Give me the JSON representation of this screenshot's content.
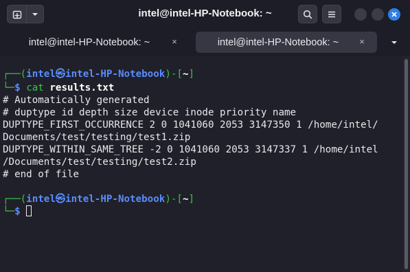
{
  "window": {
    "title": "intel@intel-HP-Notebook: ~"
  },
  "tabs": [
    {
      "label": "intel@intel-HP-Notebook: ~",
      "close": "×",
      "active": false
    },
    {
      "label": "intel@intel-HP-Notebook: ~",
      "close": "×",
      "active": true
    }
  ],
  "icons": {
    "new_tab": "new-tab-icon",
    "menu_dropdown": "chevron-down-icon",
    "search": "search-icon",
    "menu": "hamburger-menu-icon",
    "minimize": "minimize-icon",
    "maximize": "maximize-icon",
    "close": "close-icon",
    "tabs_dropdown": "chevron-down-icon"
  },
  "colors": {
    "prompt_green": "#3fc24a",
    "prompt_blue": "#5a8cff",
    "close_button": "#2f7fe8",
    "background": "#1f2029"
  },
  "terminal": {
    "prompt1": {
      "corner_top": "┌──(",
      "user": "intel",
      "at_symbol": "㉿",
      "host": "intel-HP-Notebook",
      "mid": ")-[",
      "dir": "~",
      "end": "]",
      "corner_bottom": "└─",
      "dollar": "$",
      "cmd": "cat",
      "arg": "results.txt"
    },
    "output": [
      "# Automatically generated",
      "# duptype id depth size device inode priority name",
      "DUPTYPE_FIRST_OCCURRENCE 2 0 1041060 2053 3147350 1 /home/intel/",
      "Documents/test/testing/test1.zip",
      "DUPTYPE_WITHIN_SAME_TREE -2 0 1041060 2053 3147337 1 /home/intel",
      "/Documents/test/testing/test2.zip",
      "# end of file"
    ],
    "prompt2": {
      "corner_top": "┌──(",
      "user": "intel",
      "at_symbol": "㉿",
      "host": "intel-HP-Notebook",
      "mid": ")-[",
      "dir": "~",
      "end": "]",
      "corner_bottom": "└─",
      "dollar": "$"
    }
  }
}
